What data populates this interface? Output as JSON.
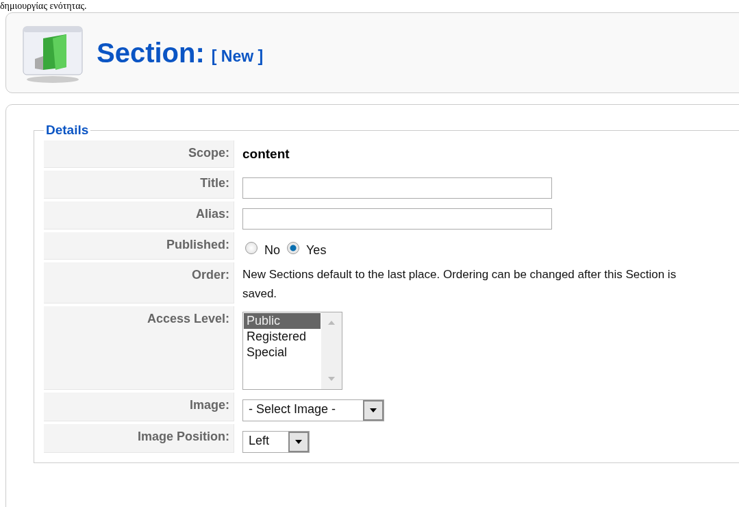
{
  "intro_text": "δημιουργίας ενότητας.",
  "header": {
    "title": "Section:",
    "subtitle": "[ New ]"
  },
  "details": {
    "legend": "Details",
    "rows": [
      {
        "kind": "text",
        "label": "Scope:",
        "value": "content"
      },
      {
        "kind": "input",
        "label": "Title:"
      },
      {
        "kind": "input",
        "label": "Alias:"
      },
      {
        "kind": "radio",
        "label": "Published:",
        "options": [
          {
            "label": "No",
            "selected": false
          },
          {
            "label": "Yes",
            "selected": true
          }
        ]
      },
      {
        "kind": "note",
        "label": "Order:",
        "value": "New Sections default to the last place. Ordering can be changed after this Section is saved."
      },
      {
        "kind": "listbox",
        "label": "Access Level:",
        "options": [
          {
            "label": "Public",
            "selected": true
          },
          {
            "label": "Registered",
            "selected": false
          },
          {
            "label": "Special",
            "selected": false
          }
        ]
      },
      {
        "kind": "select",
        "label": "Image:",
        "value": "- Select Image -"
      },
      {
        "kind": "select",
        "label": "Image Position:",
        "value": "Left"
      }
    ]
  }
}
